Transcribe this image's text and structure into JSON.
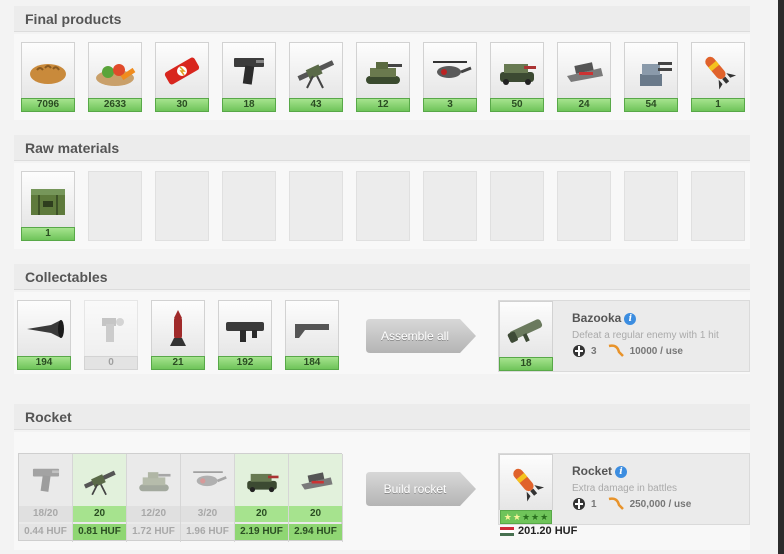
{
  "final_products": {
    "title": "Final products",
    "items": [
      {
        "name": "bread-icon",
        "count": "7096"
      },
      {
        "name": "salad-icon",
        "count": "2633"
      },
      {
        "name": "energy-bar-icon",
        "count": "30"
      },
      {
        "name": "pistol-icon",
        "count": "18"
      },
      {
        "name": "machine-gun-icon",
        "count": "43"
      },
      {
        "name": "tank-icon",
        "count": "12"
      },
      {
        "name": "helicopter-icon",
        "count": "3"
      },
      {
        "name": "armored-vehicle-icon",
        "count": "50"
      },
      {
        "name": "hovercraft-icon",
        "count": "24"
      },
      {
        "name": "turret-icon",
        "count": "54"
      },
      {
        "name": "rocket-icon",
        "count": "1"
      }
    ]
  },
  "raw_materials": {
    "title": "Raw materials",
    "items": [
      {
        "name": "ammo-crate-icon",
        "count": "1"
      }
    ]
  },
  "collectables": {
    "title": "Collectables",
    "items": [
      {
        "name": "bazooka-barrel-icon",
        "count": "194"
      },
      {
        "name": "bazooka-grip-icon",
        "count": "0"
      },
      {
        "name": "bazooka-shell-icon",
        "count": "21"
      },
      {
        "name": "bazooka-body-icon",
        "count": "192"
      },
      {
        "name": "bazooka-stock-icon",
        "count": "184"
      }
    ],
    "action_label": "Assemble all",
    "reward": {
      "title": "Bazooka",
      "description": "Defeat a regular enemy with 1 hit",
      "count": "18",
      "uses": "3",
      "price": "10000 / use"
    }
  },
  "rocket": {
    "title": "Rocket",
    "parts": [
      {
        "name": "pistol-icon",
        "progress": "18/20",
        "price": "0.44 HUF",
        "complete": false
      },
      {
        "name": "machine-gun-icon",
        "progress": "20",
        "price": "0.81 HUF",
        "complete": true
      },
      {
        "name": "tank-icon",
        "progress": "12/20",
        "price": "1.72 HUF",
        "complete": false
      },
      {
        "name": "helicopter-icon",
        "progress": "3/20",
        "price": "1.96 HUF",
        "complete": false
      },
      {
        "name": "armored-vehicle-icon",
        "progress": "20",
        "price": "2.19 HUF",
        "complete": true
      },
      {
        "name": "hovercraft-icon",
        "progress": "20",
        "price": "2.94 HUF",
        "complete": true
      }
    ],
    "action_label": "Build rocket",
    "reward": {
      "title": "Rocket",
      "description": "Extra damage in battles",
      "uses": "1",
      "price": "250,000 / use",
      "stars_filled": 2,
      "stars_total": 5
    },
    "total_price": "201.20 HUF"
  },
  "colors": {
    "count_green": "#6fc45a",
    "info_blue": "#3c8de0",
    "button_gray": "#c4c4c4"
  }
}
